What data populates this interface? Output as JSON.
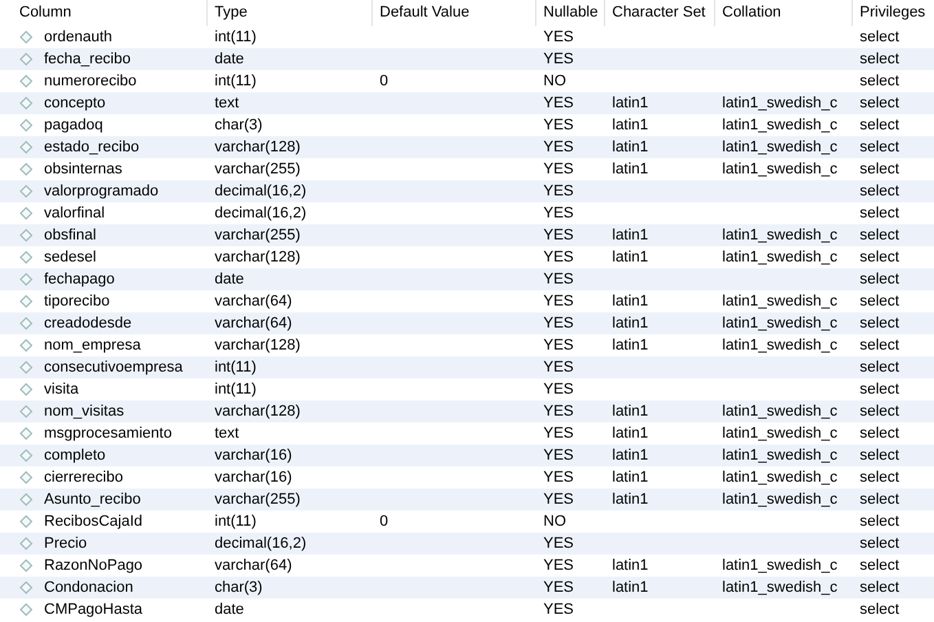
{
  "table": {
    "columns": [
      "Column",
      "Type",
      "Default Value",
      "Nullable",
      "Character Set",
      "Collation",
      "Privileges"
    ],
    "rows": [
      {
        "column": "ordenauth",
        "type": "int(11)",
        "nullable": "YES",
        "privileges": "select"
      },
      {
        "column": "fecha_recibo",
        "type": "date",
        "nullable": "YES",
        "privileges": "select"
      },
      {
        "column": "numerorecibo",
        "type": "int(11)",
        "default": "0",
        "nullable": "NO",
        "privileges": "select"
      },
      {
        "column": "concepto",
        "type": "text",
        "nullable": "YES",
        "charset": "latin1",
        "collation": "latin1_swedish_c",
        "privileges": "select"
      },
      {
        "column": "pagadoq",
        "type": "char(3)",
        "nullable": "YES",
        "charset": "latin1",
        "collation": "latin1_swedish_c",
        "privileges": "select"
      },
      {
        "column": "estado_recibo",
        "type": "varchar(128)",
        "nullable": "YES",
        "charset": "latin1",
        "collation": "latin1_swedish_c",
        "privileges": "select"
      },
      {
        "column": "obsinternas",
        "type": "varchar(255)",
        "nullable": "YES",
        "charset": "latin1",
        "collation": "latin1_swedish_c",
        "privileges": "select"
      },
      {
        "column": "valorprogramado",
        "type": "decimal(16,2)",
        "nullable": "YES",
        "privileges": "select"
      },
      {
        "column": "valorfinal",
        "type": "decimal(16,2)",
        "nullable": "YES",
        "privileges": "select"
      },
      {
        "column": "obsfinal",
        "type": "varchar(255)",
        "nullable": "YES",
        "charset": "latin1",
        "collation": "latin1_swedish_c",
        "privileges": "select"
      },
      {
        "column": "sedesel",
        "type": "varchar(128)",
        "nullable": "YES",
        "charset": "latin1",
        "collation": "latin1_swedish_c",
        "privileges": "select"
      },
      {
        "column": "fechapago",
        "type": "date",
        "nullable": "YES",
        "privileges": "select"
      },
      {
        "column": "tiporecibo",
        "type": "varchar(64)",
        "nullable": "YES",
        "charset": "latin1",
        "collation": "latin1_swedish_c",
        "privileges": "select"
      },
      {
        "column": "creadodesde",
        "type": "varchar(64)",
        "nullable": "YES",
        "charset": "latin1",
        "collation": "latin1_swedish_c",
        "privileges": "select"
      },
      {
        "column": "nom_empresa",
        "type": "varchar(128)",
        "nullable": "YES",
        "charset": "latin1",
        "collation": "latin1_swedish_c",
        "privileges": "select"
      },
      {
        "column": "consecutivoempresa",
        "type": "int(11)",
        "nullable": "YES",
        "privileges": "select"
      },
      {
        "column": "visita",
        "type": "int(11)",
        "nullable": "YES",
        "privileges": "select"
      },
      {
        "column": "nom_visitas",
        "type": "varchar(128)",
        "nullable": "YES",
        "charset": "latin1",
        "collation": "latin1_swedish_c",
        "privileges": "select"
      },
      {
        "column": "msgprocesamiento",
        "type": "text",
        "nullable": "YES",
        "charset": "latin1",
        "collation": "latin1_swedish_c",
        "privileges": "select"
      },
      {
        "column": "completo",
        "type": "varchar(16)",
        "nullable": "YES",
        "charset": "latin1",
        "collation": "latin1_swedish_c",
        "privileges": "select"
      },
      {
        "column": "cierrerecibo",
        "type": "varchar(16)",
        "nullable": "YES",
        "charset": "latin1",
        "collation": "latin1_swedish_c",
        "privileges": "select"
      },
      {
        "column": "Asunto_recibo",
        "type": "varchar(255)",
        "nullable": "YES",
        "charset": "latin1",
        "collation": "latin1_swedish_c",
        "privileges": "select"
      },
      {
        "column": "RecibosCajaId",
        "type": "int(11)",
        "default": "0",
        "nullable": "NO",
        "privileges": "select"
      },
      {
        "column": "Precio",
        "type": "decimal(16,2)",
        "nullable": "YES",
        "privileges": "select"
      },
      {
        "column": "RazonNoPago",
        "type": "varchar(64)",
        "nullable": "YES",
        "charset": "latin1",
        "collation": "latin1_swedish_c",
        "privileges": "select"
      },
      {
        "column": "Condonacion",
        "type": "char(3)",
        "nullable": "YES",
        "charset": "latin1",
        "collation": "latin1_swedish_c",
        "privileges": "select"
      },
      {
        "column": "CMPagoHasta",
        "type": "date",
        "nullable": "YES",
        "privileges": "select"
      }
    ]
  }
}
